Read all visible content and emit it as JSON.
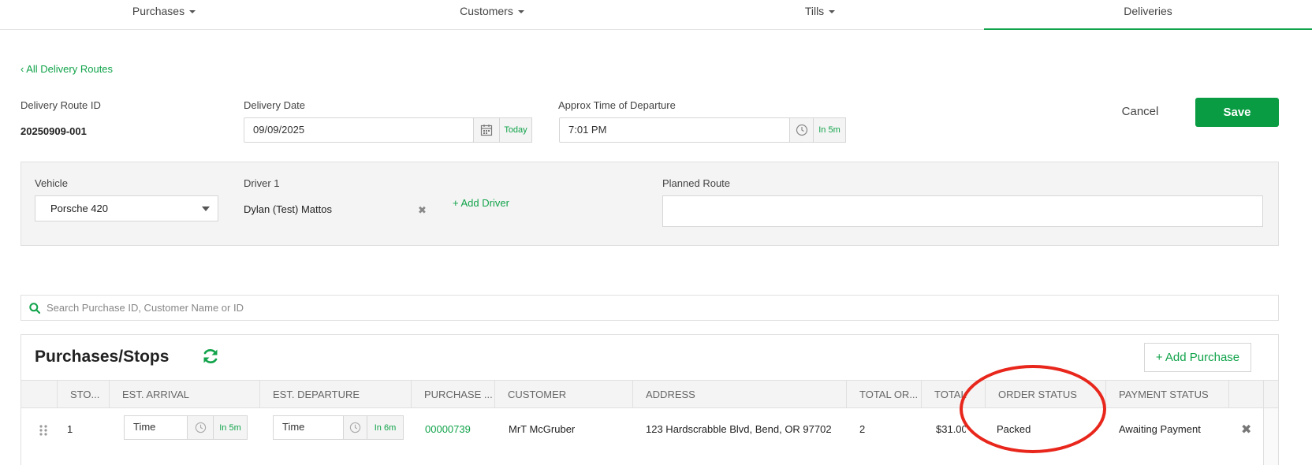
{
  "nav": {
    "tabs": [
      {
        "label": "Purchases"
      },
      {
        "label": "Customers"
      },
      {
        "label": "Tills"
      },
      {
        "label": "Deliveries"
      }
    ]
  },
  "back_link": "‹ All Delivery Routes",
  "route_id": {
    "label": "Delivery Route ID",
    "value": "20250909-001"
  },
  "delivery_date": {
    "label": "Delivery Date",
    "value": "09/09/2025",
    "today_label": "Today"
  },
  "departure": {
    "label": "Approx Time of Departure",
    "value": "7:01 PM",
    "quick_label": "In 5m"
  },
  "actions": {
    "cancel": "Cancel",
    "save": "Save"
  },
  "vehicle": {
    "label": "Vehicle",
    "value": "Porsche 420"
  },
  "driver": {
    "label": "Driver 1",
    "name": "Dylan (Test) Mattos",
    "add_label": "+ Add Driver"
  },
  "planned_route": {
    "label": "Planned Route",
    "value": ""
  },
  "search": {
    "placeholder": "Search Purchase ID, Customer Name or ID"
  },
  "stops": {
    "title": "Purchases/Stops",
    "add_label": "+ Add Purchase",
    "columns": [
      "STO...",
      "EST. ARRIVAL",
      "EST. DEPARTURE",
      "PURCHASE ...",
      "CUSTOMER",
      "ADDRESS",
      "TOTAL OR...",
      "TOTAL",
      "ORDER STATUS",
      "PAYMENT STATUS"
    ],
    "rows": [
      {
        "stop": "1",
        "arrival_placeholder": "Time",
        "arrival_quick": "In 5m",
        "departure_placeholder": "Time",
        "departure_quick": "In 6m",
        "purchase_id": "00000739",
        "customer": "MrT McGruber",
        "address": "123 Hardscrabble Blvd, Bend, OR 97702",
        "total_orders": "2",
        "total": "$31.00",
        "order_status": "Packed",
        "payment_status": "Awaiting Payment"
      }
    ]
  },
  "colors": {
    "accent": "#11a34a",
    "save": "#0a9c43",
    "annotation": "#e8261b"
  }
}
